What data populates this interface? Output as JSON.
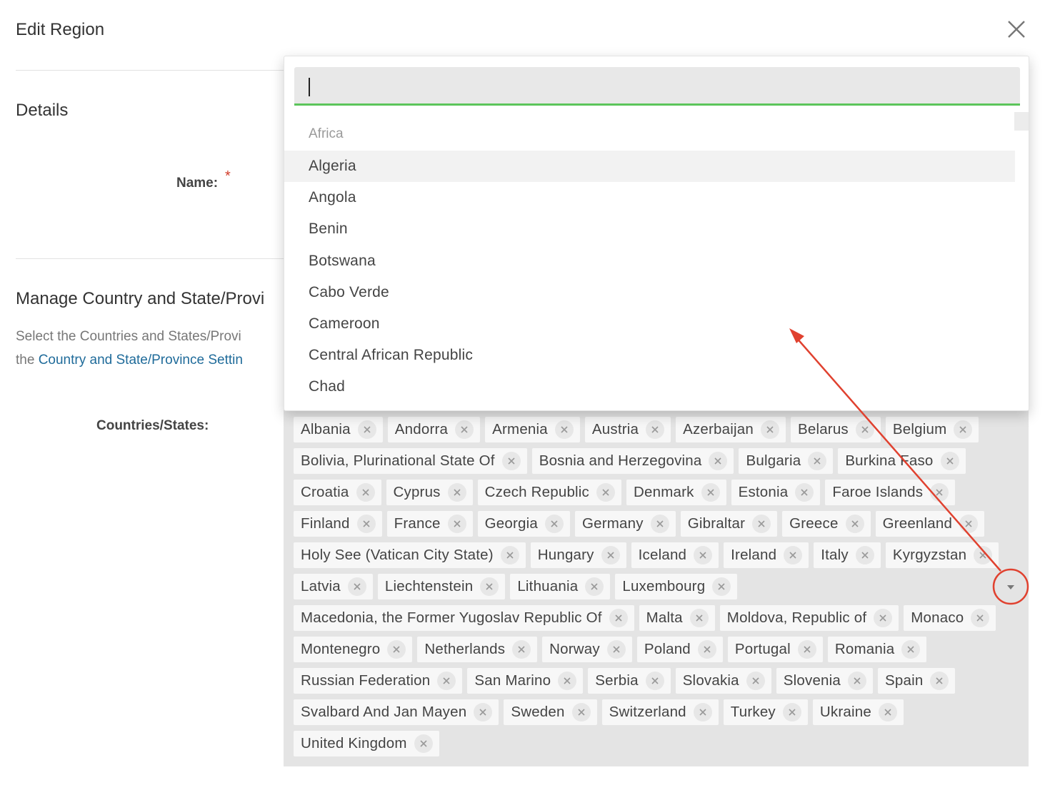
{
  "dialog": {
    "title": "Edit Region",
    "details_heading": "Details",
    "name_label": "Name:",
    "required_marker": "*",
    "manage_heading": "Manage Country and State/Provi",
    "desc_line1": "Select the Countries and States/Provi",
    "desc_line2_prefix": "the ",
    "desc_link": "Country and State/Province Settin",
    "countries_label": "Countries/States:"
  },
  "dropdown": {
    "search_value": "",
    "group_label": "Africa",
    "options": [
      "Algeria",
      "Angola",
      "Benin",
      "Botswana",
      "Cabo Verde",
      "Cameroon",
      "Central African Republic",
      "Chad"
    ],
    "highlighted_index": 0
  },
  "selected_tags": [
    "Albania",
    "Andorra",
    "Armenia",
    "Austria",
    "Azerbaijan",
    "Belarus",
    "Belgium",
    "Bolivia, Plurinational State Of",
    "Bosnia and Herzegovina",
    "Bulgaria",
    "Burkina Faso",
    "Croatia",
    "Cyprus",
    "Czech Republic",
    "Denmark",
    "Estonia",
    "Faroe Islands",
    "Finland",
    "France",
    "Georgia",
    "Germany",
    "Gibraltar",
    "Greece",
    "Greenland",
    "Holy See (Vatican City State)",
    "Hungary",
    "Iceland",
    "Ireland",
    "Italy",
    "Kyrgyzstan",
    "Latvia",
    "Liechtenstein",
    "Lithuania",
    "Luxembourg",
    "Macedonia, the Former Yugoslav Republic Of",
    "Malta",
    "Moldova, Republic of",
    "Monaco",
    "Montenegro",
    "Netherlands",
    "Norway",
    "Poland",
    "Portugal",
    "Romania",
    "Russian Federation",
    "San Marino",
    "Serbia",
    "Slovakia",
    "Slovenia",
    "Spain",
    "Svalbard And Jan Mayen",
    "Sweden",
    "Switzerland",
    "Turkey",
    "Ukraine",
    "United Kingdom"
  ],
  "colors": {
    "accent_green": "#5cc55b",
    "link": "#1f6b9a",
    "required": "#d23c2a",
    "annotation_red": "#e0412f"
  }
}
